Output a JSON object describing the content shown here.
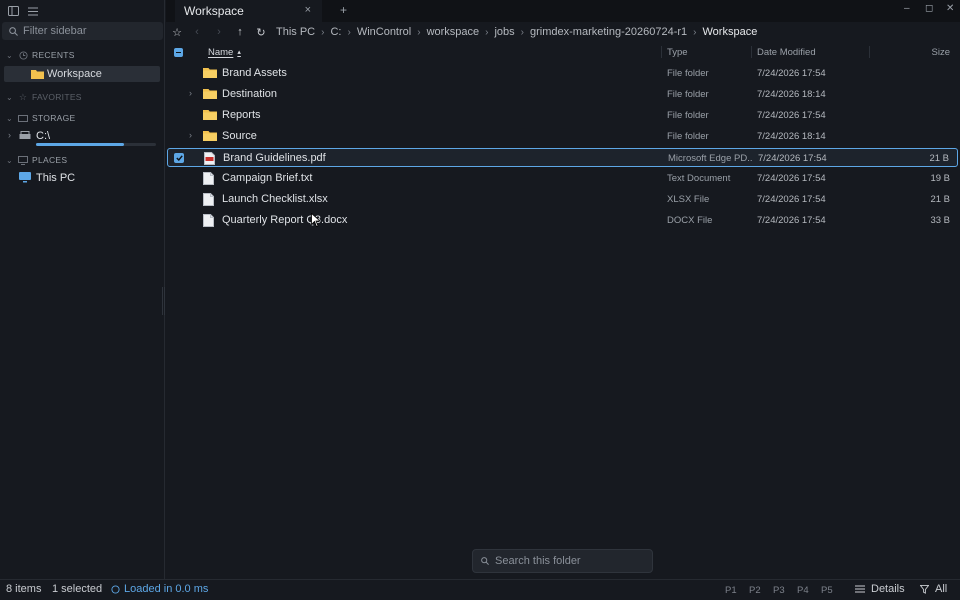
{
  "sidebar": {
    "filter_placeholder": "Filter sidebar",
    "sections": {
      "recents": "RECENTS",
      "favorites": "FAVORITES",
      "storage": "STORAGE",
      "places": "PLACES"
    },
    "recents_items": [
      "Workspace"
    ],
    "storage_items": [
      {
        "label": "C:\\",
        "used_fraction": 0.73
      }
    ],
    "places_items": [
      "This PC"
    ]
  },
  "tabs": [
    {
      "label": "Workspace",
      "close": "×"
    }
  ],
  "tab_add": "+",
  "window_controls": {
    "minimize": "–",
    "maximize": "◻",
    "close": "✕"
  },
  "breadcrumb": [
    "This PC",
    "C:",
    "WinControl",
    "workspace",
    "jobs",
    "grimdex-marketing-20260724-r1",
    "Workspace"
  ],
  "columns": {
    "name": "Name",
    "type": "Type",
    "date": "Date Modified",
    "size": "Size",
    "sort_indicator": "▴"
  },
  "files": [
    {
      "name": "Brand Assets",
      "kind": "folder",
      "type": "File folder",
      "date": "7/24/2026 17:54",
      "size": "",
      "expandable": false,
      "selected": false
    },
    {
      "name": "Destination",
      "kind": "folder",
      "type": "File folder",
      "date": "7/24/2026 18:14",
      "size": "",
      "expandable": true,
      "selected": false
    },
    {
      "name": "Reports",
      "kind": "folder",
      "type": "File folder",
      "date": "7/24/2026 17:54",
      "size": "",
      "expandable": false,
      "selected": false
    },
    {
      "name": "Source",
      "kind": "folder",
      "type": "File folder",
      "date": "7/24/2026 18:14",
      "size": "",
      "expandable": true,
      "selected": false
    },
    {
      "name": "Brand Guidelines.pdf",
      "kind": "pdf",
      "type": "Microsoft Edge PD...",
      "date": "7/24/2026 17:54",
      "size": "21 B",
      "expandable": false,
      "selected": true
    },
    {
      "name": "Campaign Brief.txt",
      "kind": "doc",
      "type": "Text Document",
      "date": "7/24/2026 17:54",
      "size": "19 B",
      "expandable": false,
      "selected": false
    },
    {
      "name": "Launch Checklist.xlsx",
      "kind": "doc",
      "type": "XLSX File",
      "date": "7/24/2026 17:54",
      "size": "21 B",
      "expandable": false,
      "selected": false
    },
    {
      "name": "Quarterly Report Q3.docx",
      "kind": "doc",
      "type": "DOCX File",
      "date": "7/24/2026 17:54",
      "size": "33 B",
      "expandable": false,
      "selected": false
    }
  ],
  "search": {
    "placeholder": "Search this folder"
  },
  "status": {
    "items": "8 items",
    "selected": "1 selected",
    "loaded": "Loaded in 0.0 ms",
    "pages": [
      "P1",
      "P2",
      "P3",
      "P4",
      "P5"
    ],
    "view": "Details",
    "filter": "All"
  },
  "colors": {
    "accent": "#5da7e6",
    "background": "#16191f",
    "folder": "#f2c14e"
  }
}
